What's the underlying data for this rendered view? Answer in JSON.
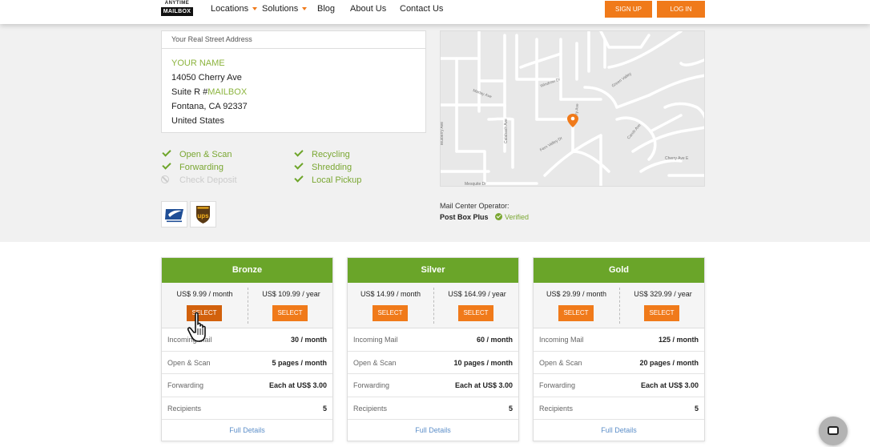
{
  "header": {
    "logo": {
      "line1": "ANYTIME",
      "line2": "MAILBOX"
    },
    "nav": [
      {
        "label": "Locations",
        "dropdown": true
      },
      {
        "label": "Solutions",
        "dropdown": true
      },
      {
        "label": "Blog",
        "dropdown": false
      },
      {
        "label": "About Us",
        "dropdown": false
      },
      {
        "label": "Contact Us",
        "dropdown": false
      }
    ],
    "signup_label": "SIGN UP",
    "login_label": "LOG IN"
  },
  "address": {
    "heading": "Your Real Street Address",
    "name_placeholder": "YOUR NAME",
    "street": "14050 Cherry Ave",
    "suite_prefix": "Suite R #",
    "suite_placeholder": "MAILBOX",
    "city_line": "Fontana, CA 92337",
    "country": "United States"
  },
  "features": [
    {
      "label": "Open & Scan",
      "enabled": true
    },
    {
      "label": "Forwarding",
      "enabled": true
    },
    {
      "label": "Check Deposit",
      "enabled": false
    },
    {
      "label": "Recycling",
      "enabled": true
    },
    {
      "label": "Shredding",
      "enabled": true
    },
    {
      "label": "Local Pickup",
      "enabled": true
    }
  ],
  "carriers": [
    "usps-logo",
    "ups-logo"
  ],
  "carrier_text": {
    "ups": "ups"
  },
  "map": {
    "streets": [
      "Mulberry Ave",
      "Marlay Ave",
      "Calabash Ave",
      "Mulberry Ave",
      "Cherry Ave",
      "Cherry Ave",
      "Windrow Dr",
      "Windrow Dr",
      "Green Valley Dr",
      "Fern Valley Dr",
      "Mesquite Dr",
      "Cherry Ave E",
      "Carob Ave"
    ]
  },
  "operator": {
    "label": "Mail Center Operator:",
    "name": "Post Box Plus",
    "verified": "Verified"
  },
  "plans": [
    {
      "name": "Bronze",
      "monthly": "US$ 9.99 / month",
      "yearly": "US$ 109.99 / year",
      "select_label": "SELECT",
      "rows": [
        {
          "label": "Incoming Mail",
          "value": "30 / month"
        },
        {
          "label": "Open & Scan",
          "value": "5 pages / month"
        },
        {
          "label": "Forwarding",
          "value": "Each at US$ 3.00"
        },
        {
          "label": "Recipients",
          "value": "5"
        }
      ],
      "details": "Full Details"
    },
    {
      "name": "Silver",
      "monthly": "US$ 14.99 / month",
      "yearly": "US$ 164.99 / year",
      "select_label": "SELECT",
      "rows": [
        {
          "label": "Incoming Mail",
          "value": "60 / month"
        },
        {
          "label": "Open & Scan",
          "value": "10 pages / month"
        },
        {
          "label": "Forwarding",
          "value": "Each at US$ 3.00"
        },
        {
          "label": "Recipients",
          "value": "5"
        }
      ],
      "details": "Full Details"
    },
    {
      "name": "Gold",
      "monthly": "US$ 29.99 / month",
      "yearly": "US$ 329.99 / year",
      "select_label": "SELECT",
      "rows": [
        {
          "label": "Incoming Mail",
          "value": "125 / month"
        },
        {
          "label": "Open & Scan",
          "value": "20 pages / month"
        },
        {
          "label": "Forwarding",
          "value": "Each at US$ 3.00"
        },
        {
          "label": "Recipients",
          "value": "5"
        }
      ],
      "details": "Full Details"
    }
  ],
  "colors": {
    "accent_orange": "#f07a1a",
    "plan_green": "#6aa529",
    "feature_green": "#7aa732",
    "link_blue": "#5d8fc9"
  }
}
